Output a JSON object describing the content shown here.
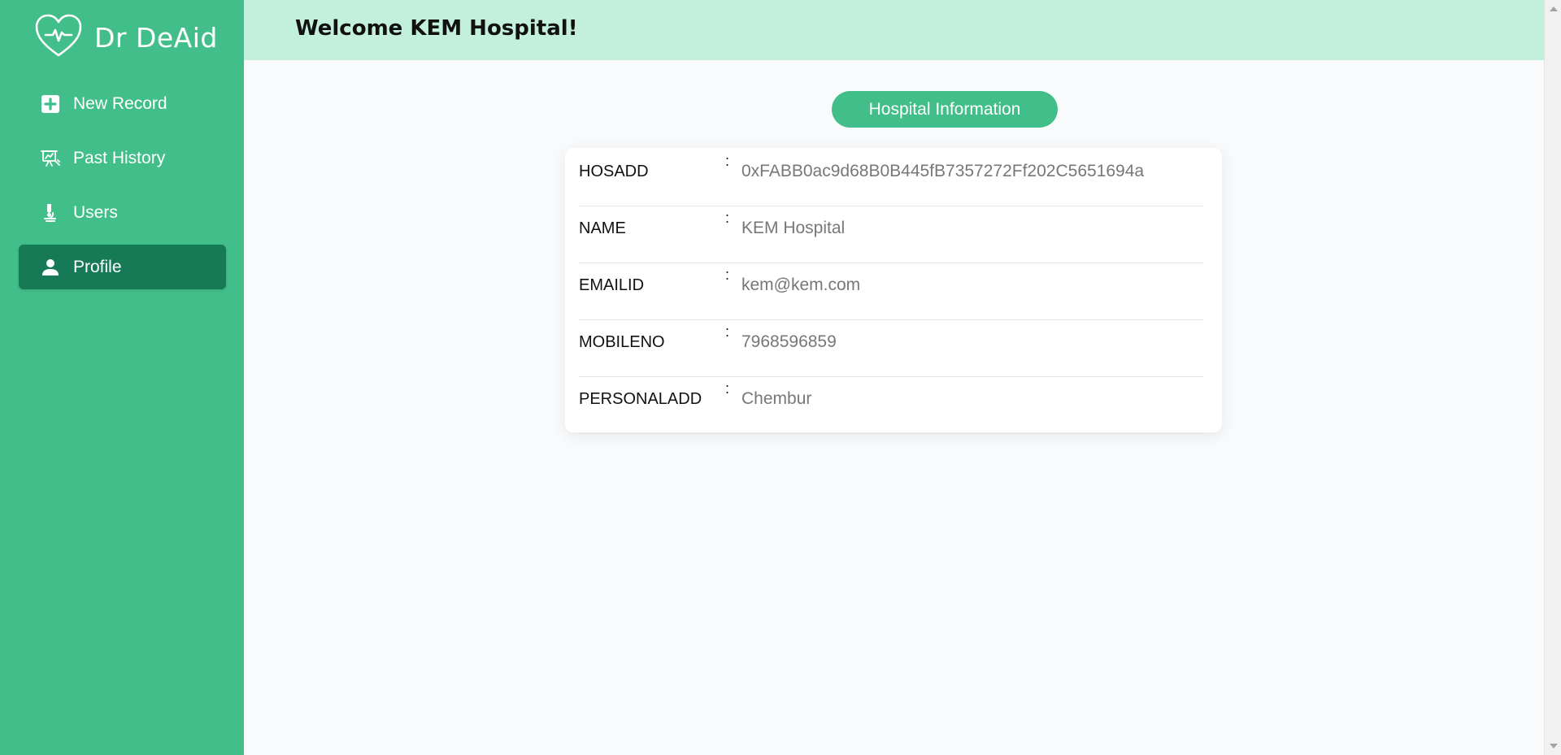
{
  "brand": {
    "name": "Dr DeAid",
    "logo_icon": "heart-pulse-icon"
  },
  "sidebar": {
    "items": [
      {
        "label": "New Record",
        "icon": "plus-square-icon",
        "active": false
      },
      {
        "label": "Past History",
        "icon": "chart-history-icon",
        "active": false
      },
      {
        "label": "Users",
        "icon": "microscope-icon",
        "active": false
      },
      {
        "label": "Profile",
        "icon": "person-icon",
        "active": true
      }
    ]
  },
  "header": {
    "title": "Welcome KEM Hospital!"
  },
  "main": {
    "section_label": "Hospital Information",
    "fields": [
      {
        "label": "HOSADD",
        "value": "0xFABB0ac9d68B0B445fB7357272Ff202C5651694a"
      },
      {
        "label": "NAME",
        "value": "KEM Hospital"
      },
      {
        "label": "EMAILID",
        "value": "kem@kem.com"
      },
      {
        "label": "MOBILENO",
        "value": "7968596859"
      },
      {
        "label": "PERSONALADD",
        "value": "Chembur"
      }
    ],
    "separator": ":"
  },
  "colors": {
    "sidebar_bg": "#42be8a",
    "active_item_bg": "#157a55",
    "header_bg": "#c3f0dc",
    "value_text": "#777777"
  }
}
